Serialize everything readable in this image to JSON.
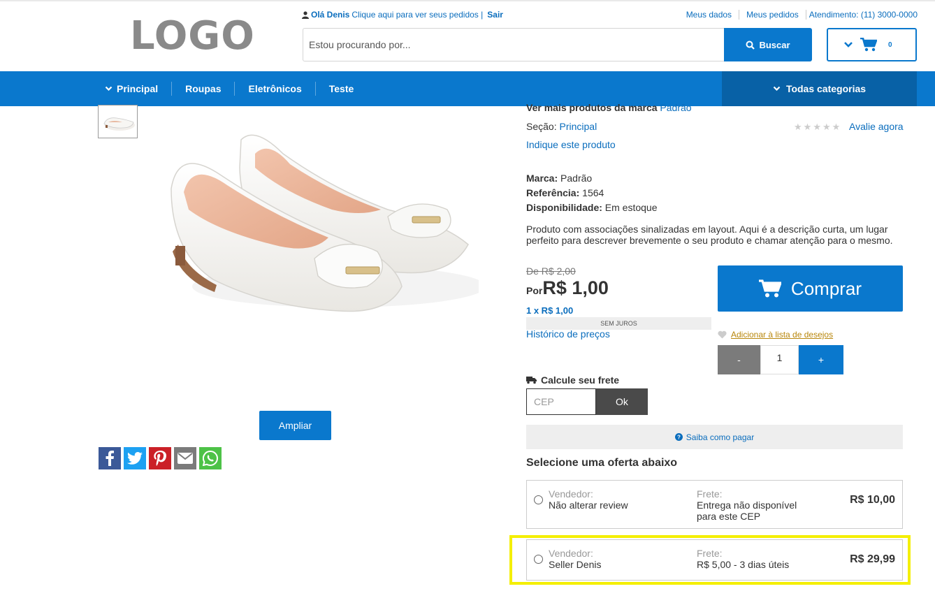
{
  "header": {
    "logo": "LOGO",
    "greeting": "Olá Denis",
    "orders_link": "Clique aqui para ver seus pedidos |",
    "logout": "Sair",
    "top_links": [
      "Meus dados",
      "Meus pedidos",
      "Atendimento: (11) 3000-0000"
    ],
    "search_placeholder": "Estou procurando por...",
    "search_button": "Buscar",
    "cart_count": "0"
  },
  "nav": {
    "items": [
      "Principal",
      "Roupas",
      "Eletrônicos",
      "Teste"
    ],
    "all_categories": "Todas categorias"
  },
  "product": {
    "brand_line_label": "Ver mais produtos da marca",
    "brand_line_value": "Padrão",
    "section_label": "Seção:",
    "section_value": "Principal",
    "recommend": "Indique este produto",
    "rate_link": "Avalie agora",
    "brand_label": "Marca:",
    "brand": "Padrão",
    "ref_label": "Referência:",
    "ref": "1564",
    "avail_label": "Disponibilidade:",
    "availability": "Em estoque",
    "description": "Produto com associações sinalizadas em layout. Aqui é a descrição curta, um lugar perfeito para descrever brevemente o seu produto e chamar atenção para o mesmo.",
    "old_price": "De R$ 2,00",
    "price_label": "Por",
    "price": "R$ 1,00",
    "installments": "1 x R$ 1,00",
    "interest": "SEM JUROS",
    "price_history": "Histórico de preços",
    "buy_button": "Comprar",
    "wishlist": "Adicionar à lista de desejos",
    "qty_minus": "-",
    "qty_value": "1",
    "qty_plus": "+",
    "zoom_button": "Ampliar"
  },
  "shipping": {
    "title": "Calcule seu frete",
    "cep_placeholder": "CEP",
    "ok_button": "Ok",
    "how_to_pay": "Saiba como pagar"
  },
  "offers": {
    "title": "Selecione uma oferta abaixo",
    "list": [
      {
        "seller_label": "Vendedor:",
        "seller": "Não alterar review",
        "shipping_label": "Frete:",
        "shipping_line1": "Entrega não disponível",
        "shipping_line2": "para este CEP",
        "price": "R$ 10,00"
      },
      {
        "seller_label": "Vendedor:",
        "seller": "Seller Denis",
        "shipping_label": "Frete:",
        "shipping_line1": "R$ 5,00 - 3 dias úteis",
        "shipping_line2": "",
        "price": "R$ 29,99"
      }
    ]
  },
  "social": [
    "facebook-icon",
    "twitter-icon",
    "pinterest-icon",
    "email-icon",
    "whatsapp-icon"
  ],
  "colors": {
    "primary": "#0a78cd",
    "primary_dark": "#0861a6",
    "highlight": "#f4ef00"
  }
}
